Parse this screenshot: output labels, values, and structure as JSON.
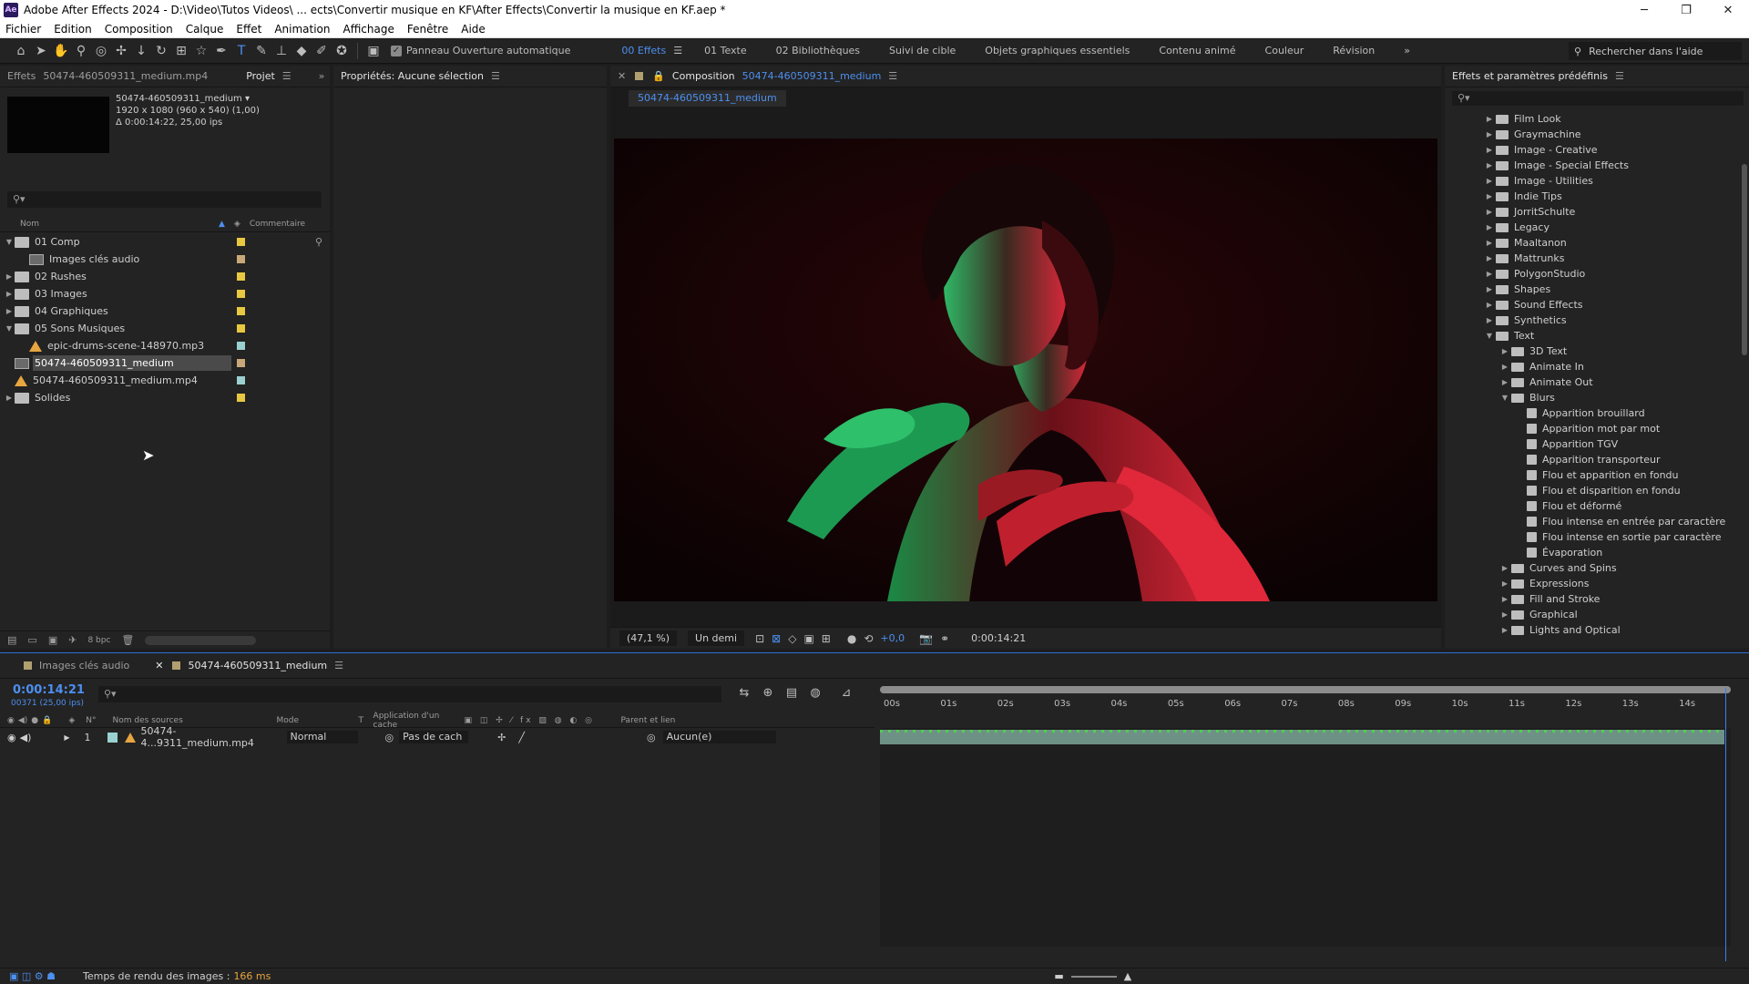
{
  "window": {
    "title": "Adobe After Effects 2024 - D:\\Video\\Tutos Videos\\ ... ects\\Convertir musique en KF\\After Effects\\Convertir la musique en KF.aep *"
  },
  "menu": [
    "Fichier",
    "Edition",
    "Composition",
    "Calque",
    "Effet",
    "Animation",
    "Affichage",
    "Fenêtre",
    "Aide"
  ],
  "toolbar": {
    "auto_open_label": "Panneau Ouverture automatique",
    "workspaces": [
      "00 Effets",
      "01 Texte",
      "02 Bibliothèques",
      "Suivi de cible",
      "Objets graphiques essentiels",
      "Contenu animé",
      "Couleur",
      "Révision"
    ],
    "help_search_placeholder": "Rechercher dans l'aide"
  },
  "project": {
    "tab_effects": "Effets",
    "tab_effects_file": "50474-460509311_medium.mp4",
    "tab_project": "Projet",
    "selected_name": "50474-460509311_medium ▾",
    "selected_dims": "1920 x 1080  (960 x 540) (1,00)",
    "selected_duration": "Δ 0:00:14:22, 25,00 ips",
    "col_name": "Nom",
    "col_comment": "Commentaire",
    "items": [
      {
        "name": "01 Comp",
        "type": "folder",
        "open": true,
        "indent": 0,
        "label": "#e8c840"
      },
      {
        "name": "Images clés audio",
        "type": "comp",
        "open": false,
        "indent": 1,
        "label": "#c8a878"
      },
      {
        "name": "02 Rushes",
        "type": "folder",
        "open": false,
        "indent": 0,
        "label": "#e8c840"
      },
      {
        "name": "03 Images",
        "type": "folder",
        "open": false,
        "indent": 0,
        "label": "#e8c840"
      },
      {
        "name": "04 Graphiques",
        "type": "folder",
        "open": false,
        "indent": 0,
        "label": "#e8c840"
      },
      {
        "name": "05 Sons Musiques",
        "type": "folder",
        "open": true,
        "indent": 0,
        "label": "#e8c840"
      },
      {
        "name": "epic-drums-scene-148970.mp3",
        "type": "audio",
        "open": false,
        "indent": 1,
        "label": "#9ad0d0"
      },
      {
        "name": "50474-460509311_medium",
        "type": "comp",
        "open": false,
        "indent": 0,
        "label": "#c8a878",
        "selected": true
      },
      {
        "name": "50474-460509311_medium.mp4",
        "type": "audio",
        "open": false,
        "indent": 0,
        "label": "#9ad0d0"
      },
      {
        "name": "Solides",
        "type": "folder",
        "open": false,
        "indent": 0,
        "label": "#e8c840"
      }
    ],
    "bpc": "8 bpc"
  },
  "properties": {
    "title": "Propriétés: Aucune sélection"
  },
  "composition": {
    "label": "Composition",
    "name": "50474-460509311_medium",
    "tab": "50474-460509311_medium",
    "zoom": "(47,1 %)",
    "resolution": "Un demi",
    "exposure": "+0,0",
    "timecode": "0:00:14:21"
  },
  "effects": {
    "title": "Effets et paramètres prédéfinis",
    "tree": [
      {
        "name": "Film Look",
        "level": 0,
        "kind": "folder",
        "open": false
      },
      {
        "name": "Graymachine",
        "level": 0,
        "kind": "folder",
        "open": false
      },
      {
        "name": "Image - Creative",
        "level": 0,
        "kind": "folder",
        "open": false
      },
      {
        "name": "Image - Special Effects",
        "level": 0,
        "kind": "folder",
        "open": false
      },
      {
        "name": "Image - Utilities",
        "level": 0,
        "kind": "folder",
        "open": false
      },
      {
        "name": "Indie Tips",
        "level": 0,
        "kind": "folder",
        "open": false
      },
      {
        "name": "JorritSchulte",
        "level": 0,
        "kind": "folder",
        "open": false
      },
      {
        "name": "Legacy",
        "level": 0,
        "kind": "folder",
        "open": false
      },
      {
        "name": "Maaltanon",
        "level": 0,
        "kind": "folder",
        "open": false
      },
      {
        "name": "Mattrunks",
        "level": 0,
        "kind": "folder",
        "open": false
      },
      {
        "name": "PolygonStudio",
        "level": 0,
        "kind": "folder",
        "open": false
      },
      {
        "name": "Shapes",
        "level": 0,
        "kind": "folder",
        "open": false
      },
      {
        "name": "Sound Effects",
        "level": 0,
        "kind": "folder",
        "open": false
      },
      {
        "name": "Synthetics",
        "level": 0,
        "kind": "folder",
        "open": false
      },
      {
        "name": "Text",
        "level": 0,
        "kind": "folder",
        "open": true
      },
      {
        "name": "3D Text",
        "level": 1,
        "kind": "folder",
        "open": false
      },
      {
        "name": "Animate In",
        "level": 1,
        "kind": "folder",
        "open": false
      },
      {
        "name": "Animate Out",
        "level": 1,
        "kind": "folder",
        "open": false
      },
      {
        "name": "Blurs",
        "level": 1,
        "kind": "folder",
        "open": true
      },
      {
        "name": "Apparition brouillard",
        "level": 2,
        "kind": "preset"
      },
      {
        "name": "Apparition mot par mot",
        "level": 2,
        "kind": "preset"
      },
      {
        "name": "Apparition TGV",
        "level": 2,
        "kind": "preset"
      },
      {
        "name": "Apparition transporteur",
        "level": 2,
        "kind": "preset"
      },
      {
        "name": "Flou et apparition en fondu",
        "level": 2,
        "kind": "preset"
      },
      {
        "name": "Flou et disparition en fondu",
        "level": 2,
        "kind": "preset"
      },
      {
        "name": "Flou et déformé",
        "level": 2,
        "kind": "preset"
      },
      {
        "name": "Flou intense en entrée par caractère",
        "level": 2,
        "kind": "preset"
      },
      {
        "name": "Flou intense en sortie par caractère",
        "level": 2,
        "kind": "preset"
      },
      {
        "name": "Évaporation",
        "level": 2,
        "kind": "preset"
      },
      {
        "name": "Curves and Spins",
        "level": 1,
        "kind": "folder",
        "open": false
      },
      {
        "name": "Expressions",
        "level": 1,
        "kind": "folder",
        "open": false
      },
      {
        "name": "Fill and Stroke",
        "level": 1,
        "kind": "folder",
        "open": false
      },
      {
        "name": "Graphical",
        "level": 1,
        "kind": "folder",
        "open": false
      },
      {
        "name": "Lights and Optical",
        "level": 1,
        "kind": "folder",
        "open": false
      }
    ]
  },
  "timeline": {
    "tab1": "Images clés audio",
    "tab2": "50474-460509311_medium",
    "timecode": "0:00:14:21",
    "frames": "00371 (25,00 ips)",
    "headers": {
      "num": "N°",
      "source": "Nom des sources",
      "mode": "Mode",
      "t": "T",
      "matte": "Application d'un cache",
      "parent": "Parent et lien"
    },
    "layer": {
      "num": "1",
      "name": "50474-4...9311_medium.mp4",
      "mode": "Normal",
      "matte": "Pas de cach",
      "parent": "Aucun(e)"
    },
    "ticks": [
      "00s",
      "01s",
      "02s",
      "03s",
      "04s",
      "05s",
      "06s",
      "07s",
      "08s",
      "09s",
      "10s",
      "11s",
      "12s",
      "13s",
      "14s"
    ]
  },
  "status": {
    "label": "Temps de rendu des images :",
    "value": "166 ms"
  }
}
